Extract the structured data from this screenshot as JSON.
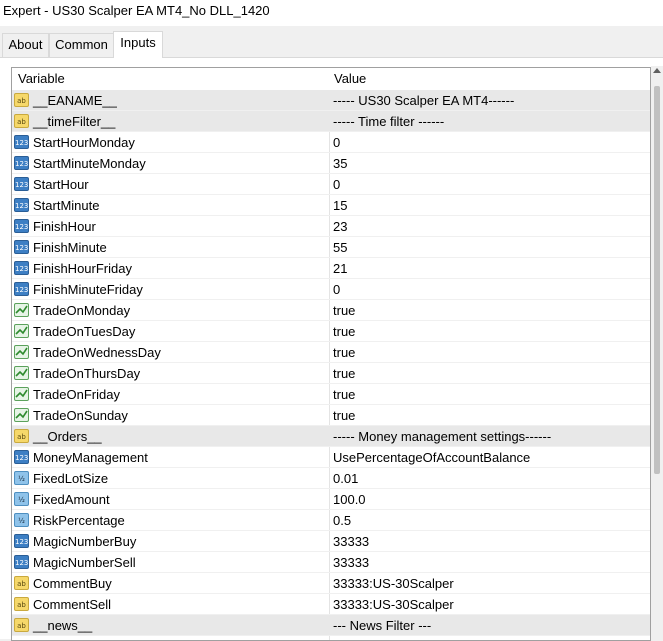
{
  "window": {
    "title": "Expert - US30 Scalper EA MT4_No DLL_1420"
  },
  "tabs": [
    {
      "label": "About"
    },
    {
      "label": "Common"
    },
    {
      "label": "Inputs"
    }
  ],
  "grid": {
    "headers": {
      "variable": "Variable",
      "value": "Value"
    },
    "rows": [
      {
        "icon": "string-icon",
        "name": "__EANAME__",
        "value": "----- US30 Scalper EA MT4------"
      },
      {
        "icon": "string-icon",
        "name": "__timeFilter__",
        "value": "----- Time filter ------"
      },
      {
        "icon": "integer-icon",
        "name": "StartHourMonday",
        "value": "0"
      },
      {
        "icon": "integer-icon",
        "name": "StartMinuteMonday",
        "value": "35"
      },
      {
        "icon": "integer-icon",
        "name": "StartHour",
        "value": "0"
      },
      {
        "icon": "integer-icon",
        "name": "StartMinute",
        "value": "15"
      },
      {
        "icon": "integer-icon",
        "name": "FinishHour",
        "value": "23"
      },
      {
        "icon": "integer-icon",
        "name": "FinishMinute",
        "value": "55"
      },
      {
        "icon": "integer-icon",
        "name": "FinishHourFriday",
        "value": "21"
      },
      {
        "icon": "integer-icon",
        "name": "FinishMinuteFriday",
        "value": "0"
      },
      {
        "icon": "boolean-icon",
        "name": "TradeOnMonday",
        "value": "true"
      },
      {
        "icon": "boolean-icon",
        "name": "TradeOnTuesDay",
        "value": "true"
      },
      {
        "icon": "boolean-icon",
        "name": "TradeOnWednessDay",
        "value": "true"
      },
      {
        "icon": "boolean-icon",
        "name": "TradeOnThursDay",
        "value": "true"
      },
      {
        "icon": "boolean-icon",
        "name": "TradeOnFriday",
        "value": "true"
      },
      {
        "icon": "boolean-icon",
        "name": "TradeOnSunday",
        "value": "true"
      },
      {
        "icon": "string-icon",
        "name": "__Orders__",
        "value": "----- Money management settings------"
      },
      {
        "icon": "integer-icon",
        "name": "MoneyManagement",
        "value": "UsePercentageOfAccountBalance"
      },
      {
        "icon": "double-icon",
        "name": "FixedLotSize",
        "value": "0.01"
      },
      {
        "icon": "double-icon",
        "name": "FixedAmount",
        "value": "100.0"
      },
      {
        "icon": "double-icon",
        "name": "RiskPercentage",
        "value": "0.5"
      },
      {
        "icon": "integer-icon",
        "name": "MagicNumberBuy",
        "value": "33333"
      },
      {
        "icon": "integer-icon",
        "name": "MagicNumberSell",
        "value": "33333"
      },
      {
        "icon": "string-icon",
        "name": "CommentBuy",
        "value": "33333:US-30Scalper"
      },
      {
        "icon": "string-icon",
        "name": "CommentSell",
        "value": "33333:US-30Scalper"
      },
      {
        "icon": "string-icon",
        "name": "__news__",
        "value": "--- News Filter ---"
      }
    ]
  },
  "icon_glyphs": {
    "string-icon": "ab",
    "integer-icon": "123",
    "double-icon": "½",
    "boolean-icon": ""
  },
  "colors": {
    "selected_row": "#e8e8e8",
    "grid_border": "#a0a0a0"
  }
}
